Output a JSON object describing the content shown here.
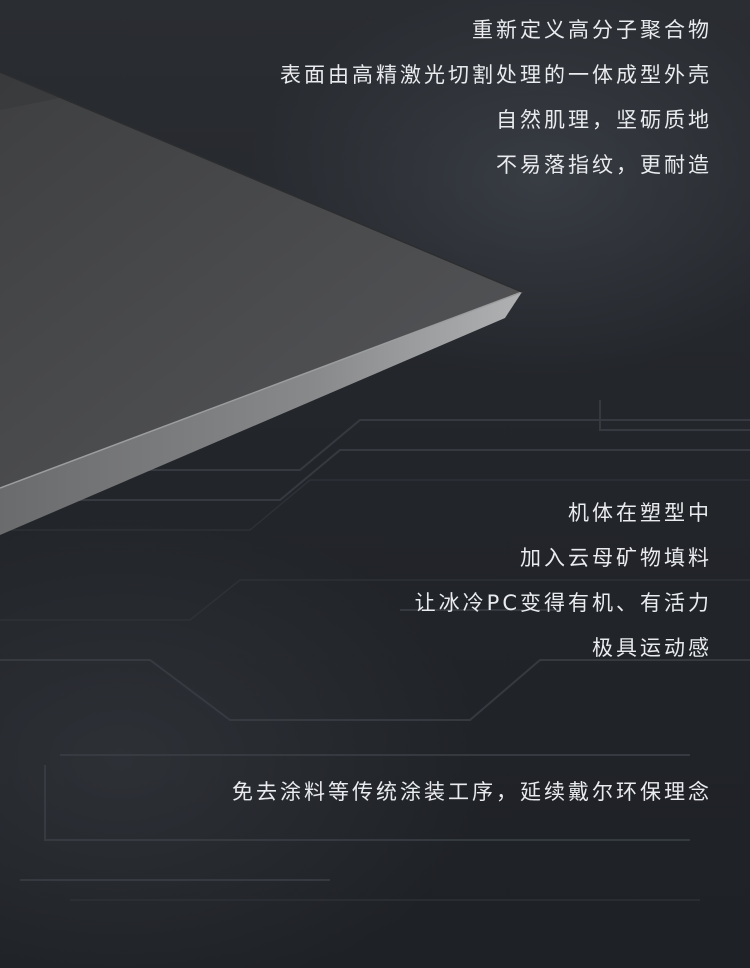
{
  "section_1": {
    "lines": [
      "重新定义高分子聚合物",
      "表面由高精激光切割处理的一体成型外壳",
      "自然肌理，坚砺质地",
      "不易落指纹，更耐造"
    ]
  },
  "section_2": {
    "lines": [
      "机体在塑型中",
      "加入云母矿物填料",
      "让冰冷PC变得有机、有活力",
      "极具运动感"
    ]
  },
  "section_3": {
    "lines": [
      "免去涂料等传统涂装工序，延续戴尔环保理念"
    ]
  },
  "colors": {
    "background": "#22252a",
    "text": "#e9ebee",
    "laptop_surface": "#4a4b4d",
    "laptop_edge": "#8a8b8d"
  }
}
